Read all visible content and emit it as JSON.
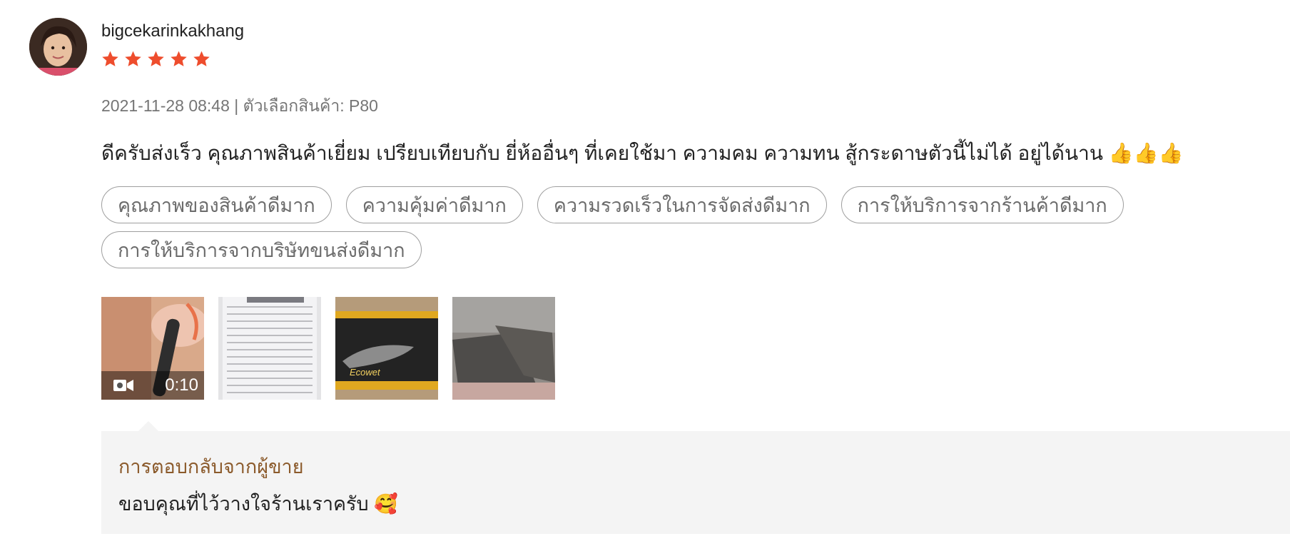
{
  "review": {
    "username": "bigcekarinkakhang",
    "rating": 5,
    "rating_max": 5,
    "star_color": "#ee4d2d",
    "meta": "2021-11-28 08:48 | ตัวเลือกสินค้า: P80",
    "comment": "ดีครับส่งเร็ว คุณภาพสินค้าเยี่ยม เปรียบเทียบกับ ยี่ห้ออื่นๆ ที่เคยใช้มา ความคม ความทน สู้กระดาษตัวนี้ไม่ได้ อยู่ได้นาน 👍👍👍",
    "tags": [
      "คุณภาพของสินค้าดีมาก",
      "ความคุ้มค่าดีมาก",
      "ความรวดเร็วในการจัดส่งดีมาก",
      "การให้บริการจากร้านค้าดีมาก",
      "การให้บริการจากบริษัทขนส่งดีมาก"
    ],
    "media": [
      {
        "type": "video",
        "duration": "0:10",
        "icon": "video-camera-icon"
      },
      {
        "type": "image"
      },
      {
        "type": "image",
        "caption": "Ecowet"
      },
      {
        "type": "image"
      }
    ]
  },
  "seller_reply": {
    "title": "การตอบกลับจากผู้ขาย",
    "text": "ขอบคุณที่ไว้วางใจร้านเราครับ 🥰"
  }
}
